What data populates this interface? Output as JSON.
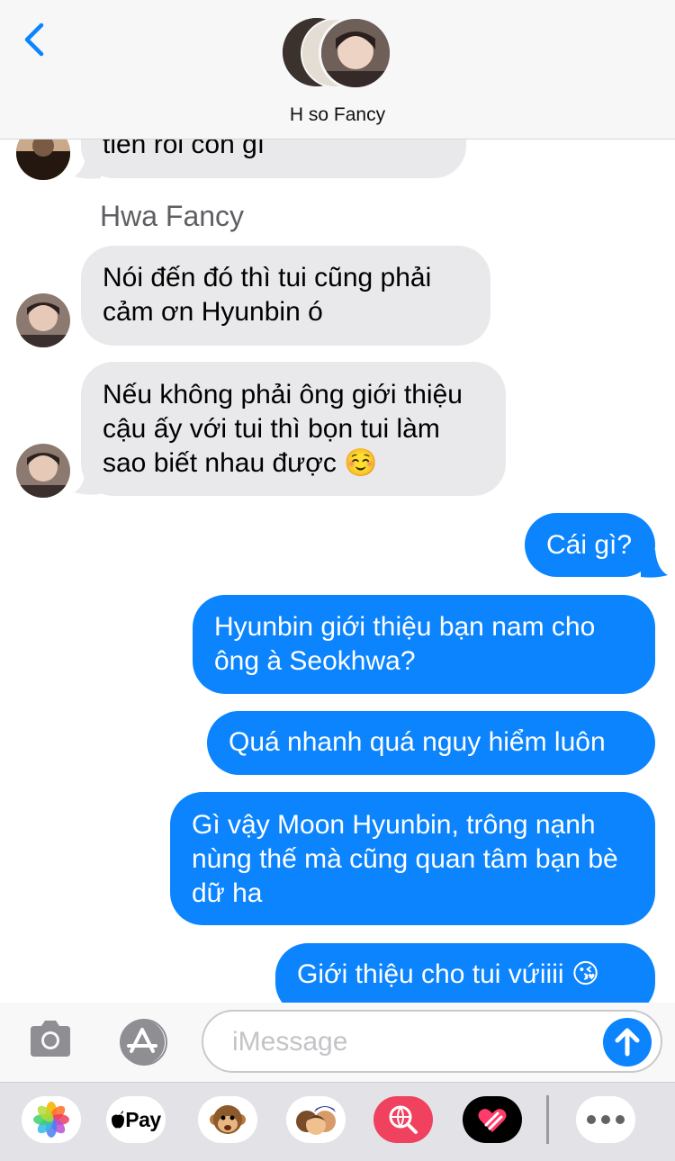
{
  "header": {
    "back_icon": "chevron-left-icon",
    "group_name": "H so Fancy",
    "accent_color": "#0b84fe"
  },
  "messages": {
    "partial_incoming": "tiền rồi còn gì",
    "sender_name": "Hwa Fancy",
    "incoming": [
      "Nói đến đó thì tui cũng phải cảm ơn Hyunbin ó",
      "Nếu không phải ông giới thiệu cậu ấy với tui thì bọn tui làm sao biết nhau được ☺️"
    ],
    "outgoing": [
      "Cái gì?",
      "Hyunbin giới thiệu bạn nam cho ông à Seokhwa?",
      "Quá nhanh quá nguy hiểm luôn",
      "Gì vậy Moon Hyunbin, trông nạnh nùng thế mà cũng quan tâm bạn bè dữ ha",
      "Giới thiệu cho tui vứiiii 😘"
    ]
  },
  "input": {
    "placeholder": "iMessage",
    "camera_icon": "camera-icon",
    "appstore_icon": "app-store-icon",
    "send_icon": "arrow-up-icon"
  },
  "drawer": {
    "apps": [
      {
        "icon": "photos-icon"
      },
      {
        "icon": "apple-pay-icon",
        "label": "Pay"
      },
      {
        "icon": "animoji-monkey-icon"
      },
      {
        "icon": "memoji-icon"
      },
      {
        "icon": "web-search-icon"
      },
      {
        "icon": "digital-touch-icon"
      },
      {
        "icon": "more-icon"
      }
    ]
  },
  "colors": {
    "incoming_bubble": "#e9e9eb",
    "outgoing_bubble": "#0b84fe"
  }
}
